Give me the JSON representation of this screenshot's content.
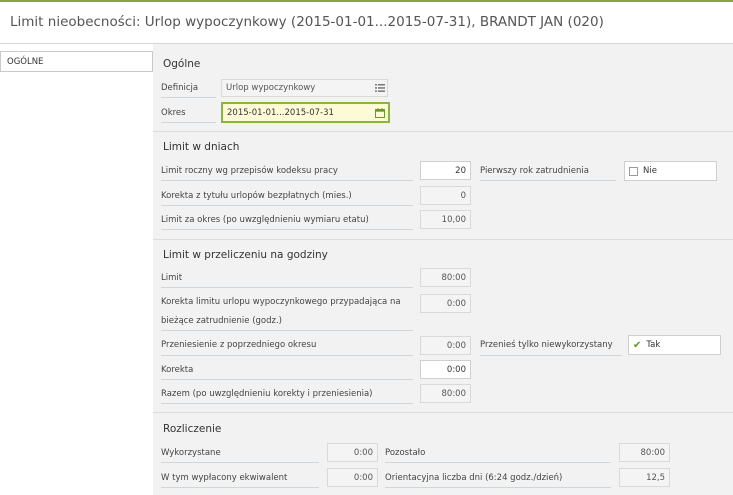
{
  "header": {
    "title": "Limit nieobecności: Urlop wypoczynkowy (2015-01-01...2015-07-31), BRANDT JAN (020)"
  },
  "nav": {
    "active": "OGÓLNE"
  },
  "colors": {
    "accent": "#8ab43c",
    "active_field_bg": "#fdfbd6",
    "panel_bg": "#f2f2f2"
  },
  "ogolne": {
    "title": "Ogólne",
    "definicja_label": "Definicja",
    "definicja_value": "Urlop wypoczynkowy",
    "okres_label": "Okres",
    "okres_value": "2015-01-01...2015-07-31"
  },
  "dni": {
    "title": "Limit w dniach",
    "limit_roczny_label": "Limit roczny wg przepisów kodeksu pracy",
    "limit_roczny_value": "20",
    "pierwszy_rok_label": "Pierwszy rok zatrudnienia",
    "pierwszy_rok_value": "Nie",
    "korekta_label": "Korekta z tytułu urlopów bezpłatnych (mies.)",
    "korekta_value": "0",
    "limit_okres_label": "Limit za okres (po uwzględnieniu wymiaru etatu)",
    "limit_okres_value": "10,00"
  },
  "godziny": {
    "title": "Limit w przeliczeniu na godziny",
    "limit_label": "Limit",
    "limit_value": "80:00",
    "korekta_limitu_label_1": "Korekta limitu urlopu wypoczynkowego przypadająca na",
    "korekta_limitu_label_2": "bieżące zatrudnienie (godz.)",
    "korekta_limitu_value": "0:00",
    "przeniesienie_label": "Przeniesienie z poprzedniego okresu",
    "przeniesienie_value": "0:00",
    "przenies_label": "Przenieś tylko niewykorzystany",
    "przenies_value": "Tak",
    "korekta_label": "Korekta",
    "korekta_value": "0:00",
    "razem_label": "Razem (po uwzględnieniu korekty i przeniesienia)",
    "razem_value": "80:00"
  },
  "rozliczenie": {
    "title": "Rozliczenie",
    "wykorzystane_label": "Wykorzystane",
    "wykorzystane_value": "0:00",
    "pozostalo_label": "Pozostało",
    "pozostalo_value": "80:00",
    "wyplacony_label": "W tym wypłacony ekwiwalent",
    "wyplacony_value": "0:00",
    "orientacyjna_label": "Orientacyjna liczba dni (6:24 godz./dzień)",
    "orientacyjna_value": "12,5"
  }
}
